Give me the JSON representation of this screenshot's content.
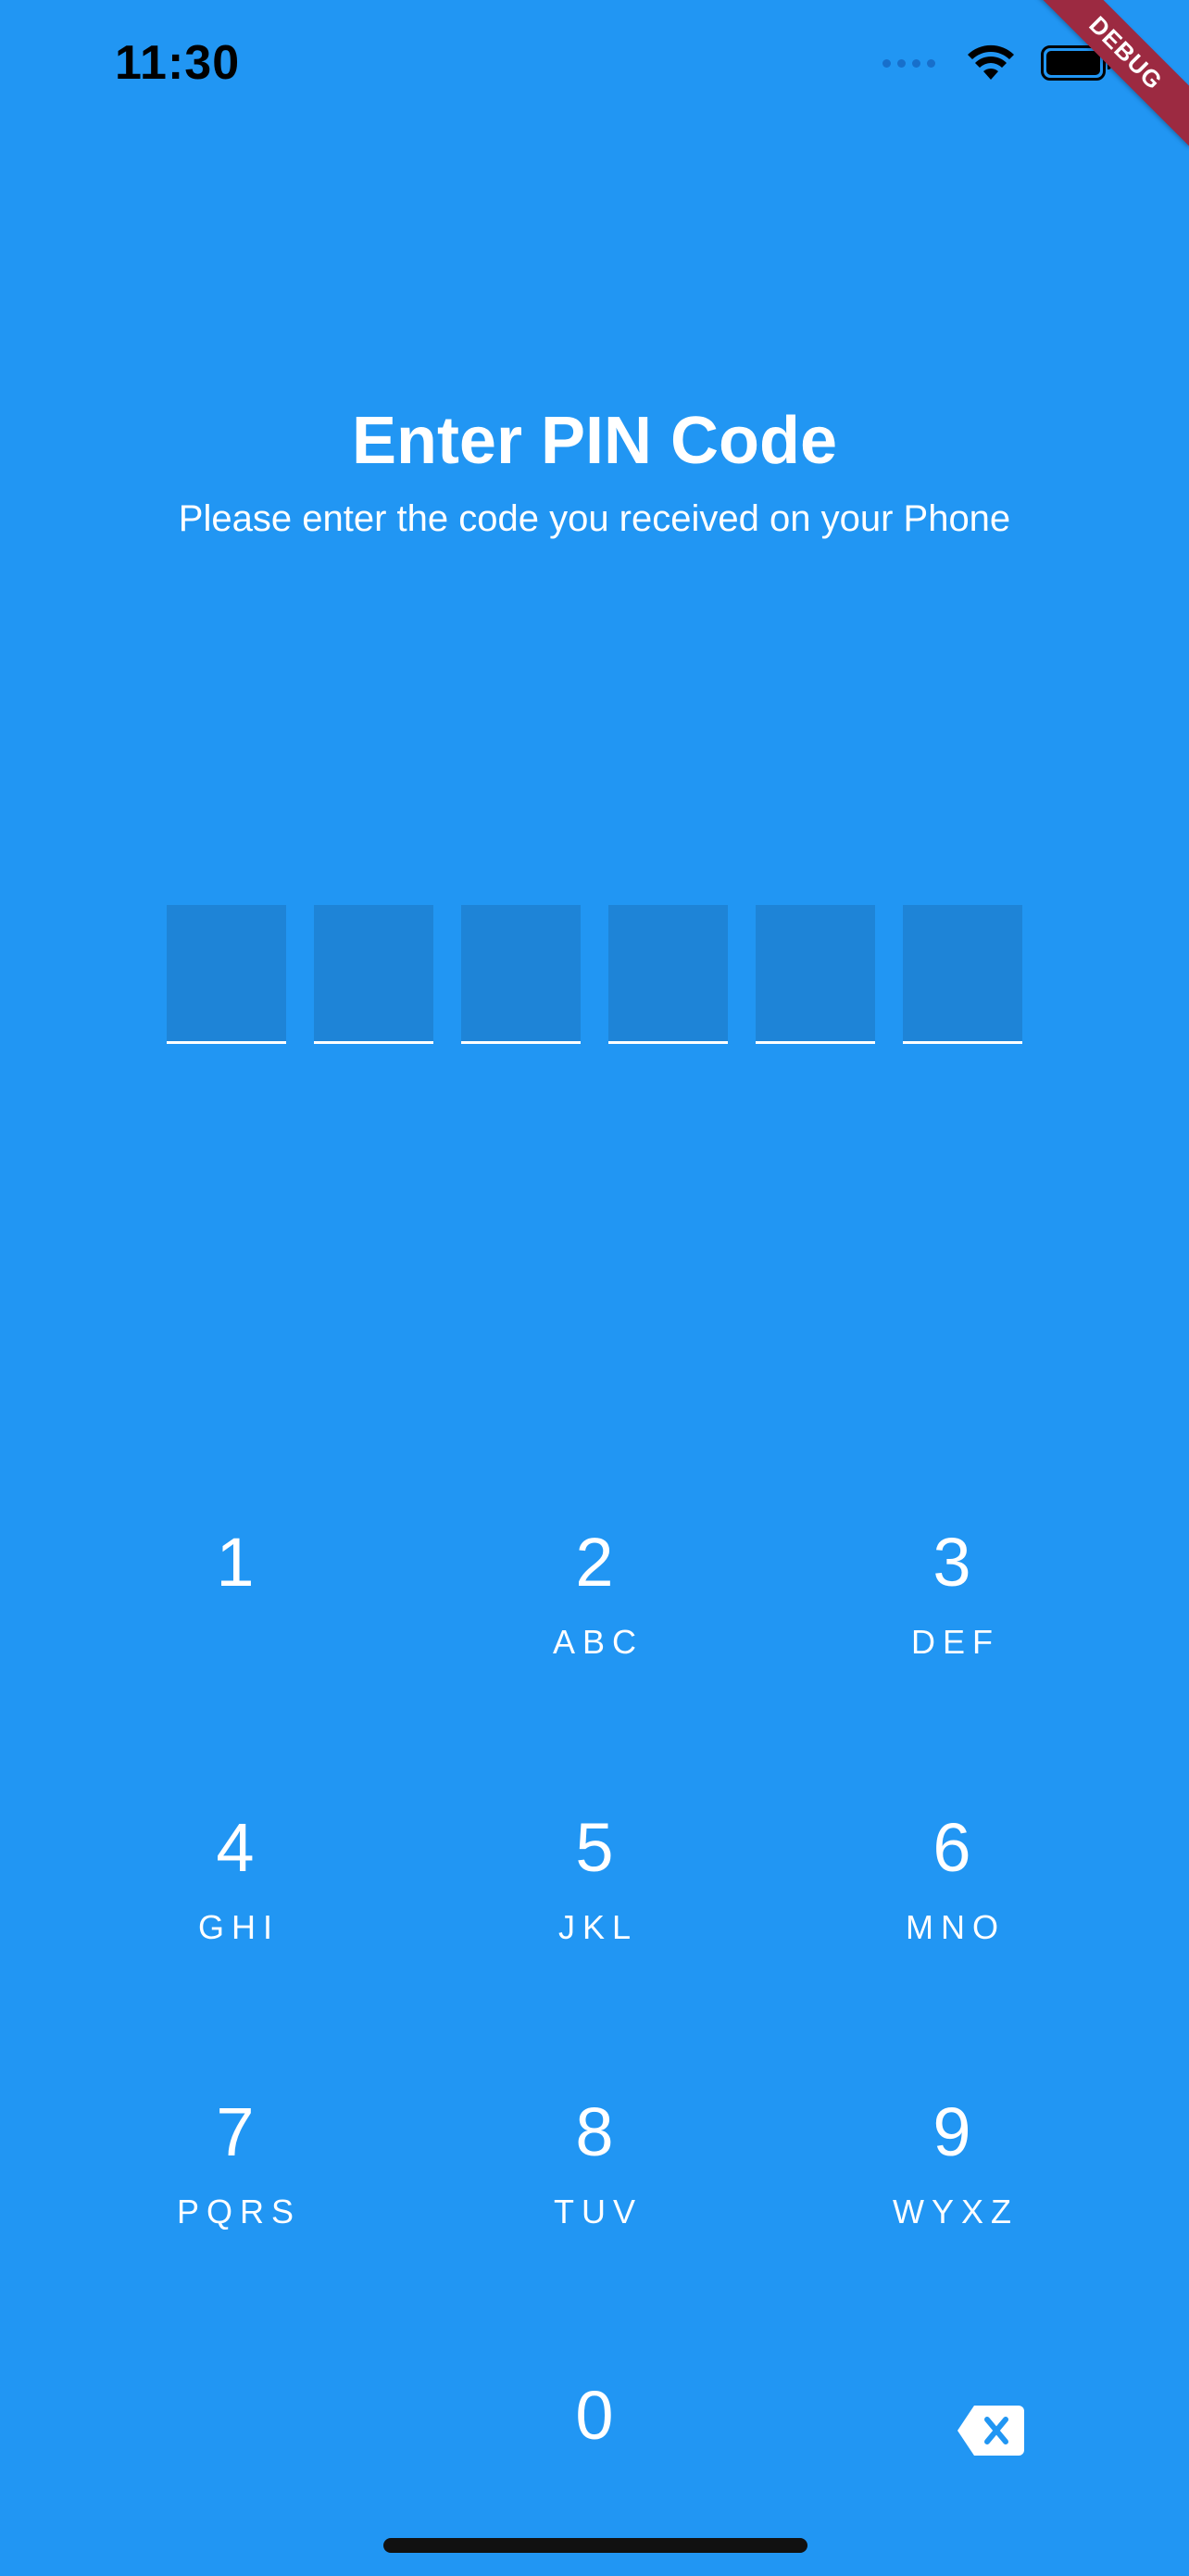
{
  "status_bar": {
    "time": "11:30"
  },
  "debug_banner": "DEBUG",
  "header": {
    "title": "Enter PIN Code",
    "subtitle": "Please enter the code you received on your Phone"
  },
  "pin": {
    "length": 6,
    "digits": [
      "",
      "",
      "",
      "",
      "",
      ""
    ]
  },
  "keypad": {
    "keys": [
      {
        "digit": "1",
        "letters": ""
      },
      {
        "digit": "2",
        "letters": "ABC"
      },
      {
        "digit": "3",
        "letters": "DEF"
      },
      {
        "digit": "4",
        "letters": "GHI"
      },
      {
        "digit": "5",
        "letters": "JKL"
      },
      {
        "digit": "6",
        "letters": "MNO"
      },
      {
        "digit": "7",
        "letters": "PQRS"
      },
      {
        "digit": "8",
        "letters": "TUV"
      },
      {
        "digit": "9",
        "letters": "WYXZ"
      },
      {
        "digit": "0",
        "letters": ""
      }
    ],
    "backspace_icon": "backspace-icon"
  },
  "colors": {
    "background": "#2196F3",
    "pin_box": "#1E84D7",
    "debug_ribbon": "#9C2A41"
  }
}
